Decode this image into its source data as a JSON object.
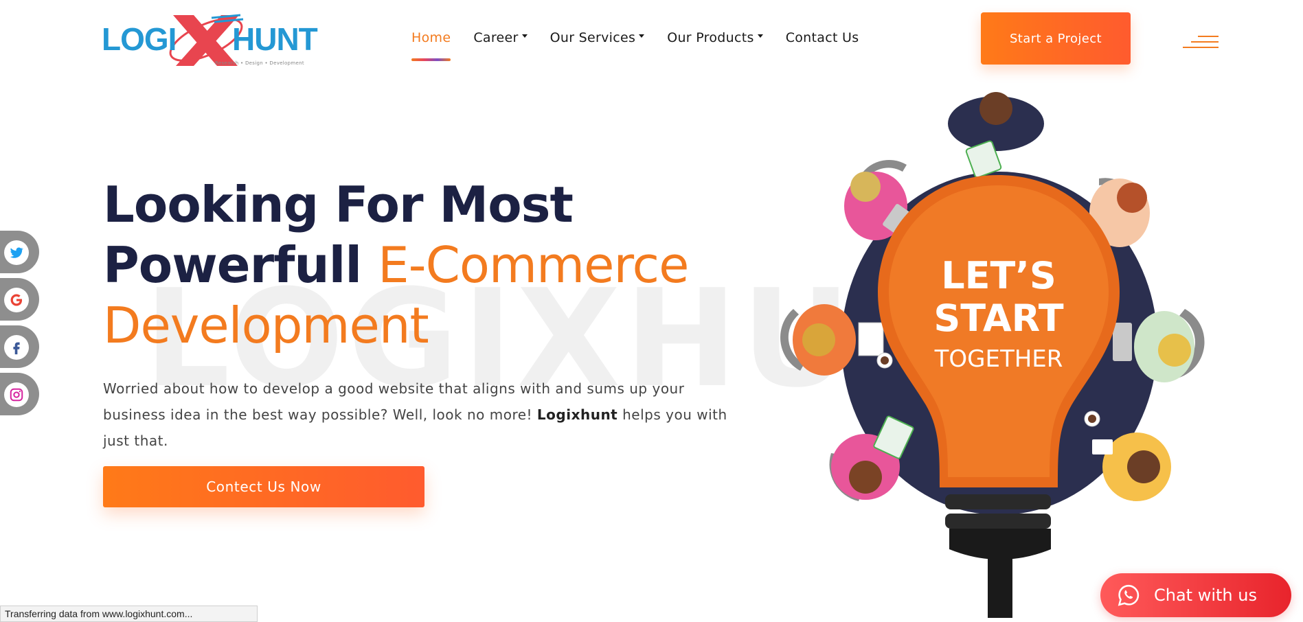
{
  "brand": {
    "logo_left": "LOGI",
    "logo_right": "HUNT",
    "tagline": "Research  •  Design  •  Development",
    "colors": {
      "logo_blue": "#2498d4",
      "logo_red": "#e8454f",
      "accent": "#f37b1f",
      "navy": "#1c2143"
    }
  },
  "nav": {
    "items": [
      {
        "label": "Home",
        "active": true
      },
      {
        "label": "Career",
        "dropdown": true
      },
      {
        "label": "Our Services",
        "dropdown": true
      },
      {
        "label": "Our Products",
        "dropdown": true
      },
      {
        "label": "Contact Us"
      }
    ],
    "cta_label": "Start a Project",
    "menu_icon": "hamburger-icon"
  },
  "social": [
    {
      "name": "twitter-icon"
    },
    {
      "name": "google-icon"
    },
    {
      "name": "facebook-icon"
    },
    {
      "name": "instagram-icon"
    }
  ],
  "hero": {
    "watermark": "LOGIXHUNT",
    "headline_line1": "Looking For Most",
    "headline_line2_dark": "Powerfull ",
    "headline_line2_orange": "E-Commerce",
    "headline_line3_orange": "Development",
    "text_before": "Worried about how to develop a good website that aligns with and sums up your business idea in the best way possible? Well, look no more! ",
    "text_brand": "Logixhunt",
    "text_after": " helps you with just that.",
    "cta_label": "Contect Us Now",
    "bulb_line1": "LET’S",
    "bulb_line2": "START",
    "bulb_line3": "TOGETHER"
  },
  "chat": {
    "label": "Chat with us",
    "icon": "whatsapp-icon"
  },
  "status_bar": {
    "text": "Transferring data from www.logixhunt.com..."
  }
}
